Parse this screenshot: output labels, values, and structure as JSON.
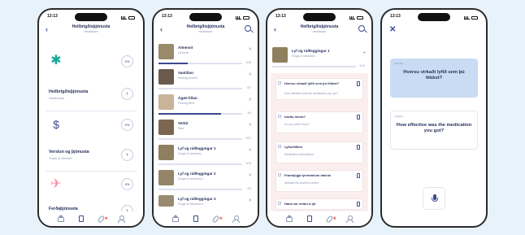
{
  "status_time": "13:13",
  "phone1": {
    "title": "Heilbrigðisþjónusta",
    "subtitle": "Healthcare",
    "categories": [
      {
        "pct": "0%",
        "name": "",
        "en": ""
      },
      {
        "pct": "0%",
        "name": "Heilbrigðisþjónusta",
        "en": "Healthcare"
      },
      {
        "pct": "0%",
        "name": "Verslun og þjónusta",
        "en": "Trade & Service"
      },
      {
        "pct": "0%",
        "name": "Ferðaþjónusta",
        "en": ""
      }
    ],
    "go_symbol": "›"
  },
  "phone2": {
    "title": "Heilbrigðisþjónusta",
    "subtitle": "Healthcare",
    "items": [
      {
        "name": "Almennt",
        "desc": "General",
        "count": "0/18",
        "progress": 0.35
      },
      {
        "name": "Vanlíðan",
        "desc": "Feeling Unwell",
        "count": "0/7",
        "progress": 0.0
      },
      {
        "name": "Ágæt líðan",
        "desc": "Feeling Well",
        "count": "3/4",
        "progress": 0.75
      },
      {
        "name": "Verkir",
        "desc": "Pain",
        "count": "0/22",
        "progress": 0.0
      },
      {
        "name": "Lyf og ráðleggingar 1 ",
        "desc": "Drugs & Infusions",
        "count": "0/13",
        "progress": 0.0
      },
      {
        "name": "Lyf og ráðleggingar 2",
        "desc": "Drugs & Infusions 2",
        "count": "0/9",
        "progress": 0.0
      },
      {
        "name": "Lyf og ráðleggingar 3",
        "desc": "Drugs & Infusions 3",
        "count": "",
        "progress": 0.0
      }
    ]
  },
  "phone3": {
    "title": "Heilbrigðisþjónusta",
    "subtitle": "Healthcare",
    "header_item": {
      "name": "Lyf og ráðleggingar 1",
      "desc": "Drugs & Infusions",
      "count": "0/13"
    },
    "questions": [
      {
        "q": "Hversu virkaði lyfið sem þú fékkst?",
        "a": "How effective was the medication you got?"
      },
      {
        "q": "Þarftu meira?",
        "a": "Do you need more?"
      },
      {
        "q": "Lyfseðillinn",
        "a": "Medication prescription"
      },
      {
        "q": "Framfylgja fyrirmælum læknis",
        "a": "Activate the doctor's orders"
      },
      {
        "q": "Hana var settur á lyf",
        "a": ""
      }
    ]
  },
  "phone4": {
    "label_is": "Íslenska",
    "question_is": "Hversu virkaði lyfið sem þú fékkst?",
    "label_en": "English",
    "question_en": "How effective was the medication you got?"
  },
  "colors": {
    "accent": "#3b4a8f",
    "card_blue": "#c9dcf4",
    "teal": "#1aa89a",
    "pink": "#ff8da8"
  }
}
